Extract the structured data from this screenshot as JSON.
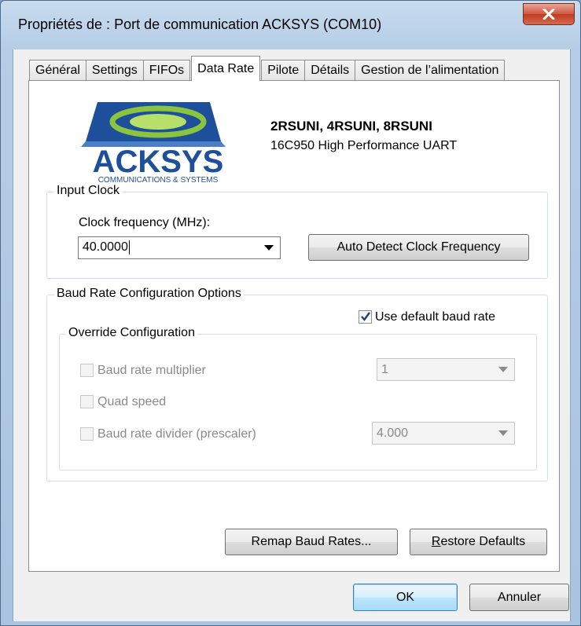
{
  "window": {
    "title": "Propriétés de : Port de communication ACKSYS (COM10)"
  },
  "tabs": [
    {
      "label": "Général"
    },
    {
      "label": "Settings"
    },
    {
      "label": "FIFOs"
    },
    {
      "label": "Data Rate",
      "active": true
    },
    {
      "label": "Pilote"
    },
    {
      "label": "Détails"
    },
    {
      "label": "Gestion de l’alimentation"
    }
  ],
  "logo": {
    "text": "ACKSYS",
    "tagline": "COMMUNICATIONS & SYSTEMS",
    "colors": {
      "dark": "#1e4f9a",
      "mid": "#4a7fc8",
      "green": "#8bc53f"
    }
  },
  "product": {
    "name": "2RSUNI, 4RSUNI, 8RSUNI",
    "description": "16C950 High Performance UART"
  },
  "input_clock": {
    "legend": "Input Clock",
    "frequency_label": "Clock frequency (MHz):",
    "frequency_value": "40.0000",
    "auto_detect_label": "Auto Detect Clock Frequency"
  },
  "baud_rate": {
    "legend": "Baud Rate Configuration Options",
    "use_default_label": "Use default baud rate",
    "use_default_checked": true,
    "override": {
      "legend": "Override Configuration",
      "multiplier_label": "Baud rate multiplier",
      "multiplier_value": "1",
      "quad_speed_label": "Quad speed",
      "divider_label": "Baud rate divider (prescaler)",
      "divider_value": "4.000"
    }
  },
  "actions": {
    "remap_label": "Remap Baud Rates...",
    "restore_label_prefix": "",
    "restore_label_mnemonic": "R",
    "restore_label_rest": "estore Defaults"
  },
  "dialog_buttons": {
    "ok_label": "OK",
    "cancel_label": "Annuler"
  }
}
